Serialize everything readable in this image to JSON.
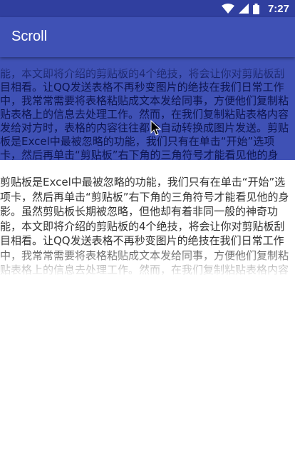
{
  "status_bar": {
    "time": "7:27",
    "icons": [
      "wifi-icon",
      "cellular-signal-icon",
      "battery-icon"
    ],
    "color": "#303f9f"
  },
  "app_bar": {
    "title": "Scroll",
    "color": "#3f51b5"
  },
  "top_scroll": {
    "text": "能，本文即将介绍的剪贴板的4个绝技，将会让你对剪贴板刮目相看。让QQ发送表格不再秒变图片的绝技在我们日常工作中，我常常需要将表格粘贴成文本发给同事，方便他们复制粘贴表格上的信息去处理工作。然而，在我们复制粘贴表格内容发给对方时，表格的内容往往都会自动转换成图片发送。剪贴板是Excel中最被忽略的功能，我们只有在单击“开始”选项卡，然后再单击“剪贴板”右下角的三角符号才能看见他的身影。虽"
  },
  "bottom_scroll": {
    "text": "剪贴板是Excel中最被忽略的功能，我们只有在单击“开始”选项卡，然后再单击“剪贴板”右下角的三角符号才能看见他的身影。虽然剪贴板长期被忽略，但他却有着非同一般的神奇功能，本文即将介绍的剪贴板的4个绝技，将会让你对剪贴板刮目相看。让QQ发送表格不再秒变图片的绝技在我们日常工作中，我常常需要将表格粘贴成文本发给同事，方便他们复制粘贴表格上的信息去处理工作。然而，在我们复制粘贴表格内容发给对方时，表格的内容往往都会自动转换成图片发送。"
  },
  "colors": {
    "primary": "#3f51b5",
    "primary_dark": "#303f9f",
    "top_text": "#0d1550",
    "body_text": "#333333"
  }
}
